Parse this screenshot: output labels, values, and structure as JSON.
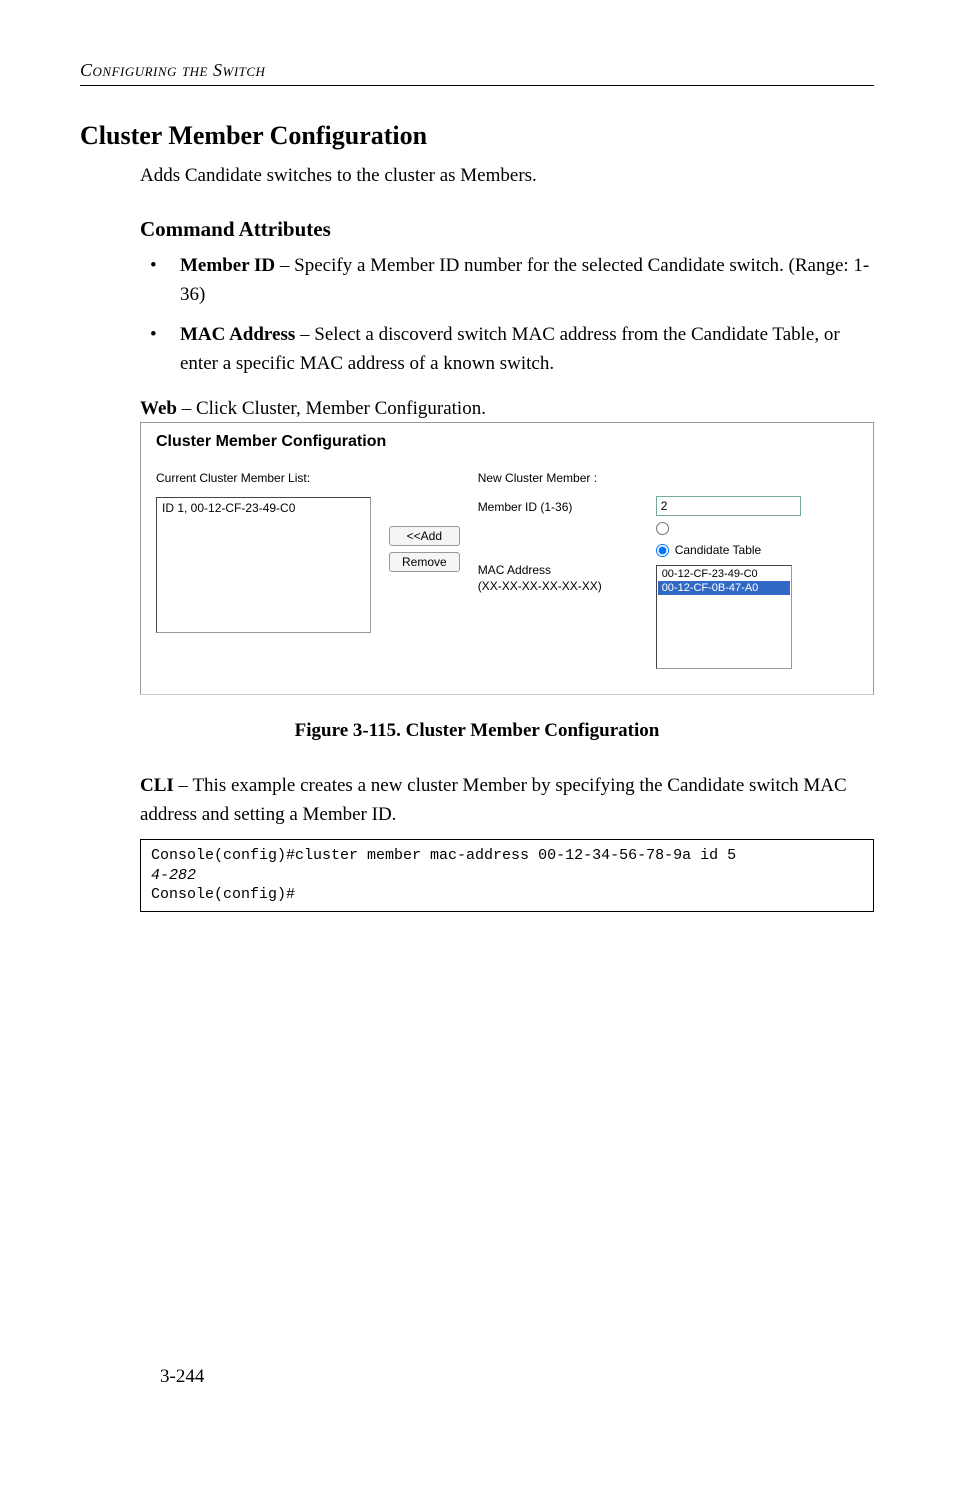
{
  "page_header": "Configuring the Switch",
  "section_title": "Cluster Member Configuration",
  "intro": "Adds Candidate switches to the cluster as Members.",
  "subsection": "Command Attributes",
  "bullets": [
    {
      "label": "Member ID",
      "desc": " – Specify a Member ID number for the selected Candidate switch. (Range: 1-36)"
    },
    {
      "label": "MAC Address",
      "desc": " – Select a discoverd switch MAC address from the Candidate Table, or enter a specific MAC address of a known switch."
    }
  ],
  "web_label": "Web",
  "web_desc": " – Click Cluster, Member Configuration.",
  "screenshot": {
    "title": "Cluster Member Configuration",
    "left": {
      "list_label": "Current Cluster Member List:",
      "items": [
        "ID 1, 00-12-CF-23-49-C0"
      ]
    },
    "buttons": {
      "add": "<<Add",
      "remove": "Remove"
    },
    "right": {
      "new_label": "New Cluster Member :",
      "member_id_label": "Member ID (1-36)",
      "member_id_value": "2",
      "mac_label_line1": "MAC Address",
      "mac_label_line2": "(XX-XX-XX-XX-XX-XX)",
      "candidate_label": "Candidate Table",
      "candidate_items": [
        "00-12-CF-23-49-C0",
        "00-12-CF-0B-47-A0"
      ],
      "selected_index": 1
    }
  },
  "figure_caption": "Figure 3-115.  Cluster Member Configuration",
  "cli_label": "CLI",
  "cli_desc": " – This example creates a new cluster Member by specifying the Candidate switch MAC address and setting a Member ID.",
  "cli_lines": {
    "line1": "Console(config)#cluster member mac-address 00-12-34-56-78-9a id 5 ",
    "line2": "4-282",
    "line3": "Console(config)#"
  },
  "page_number": "3-244"
}
